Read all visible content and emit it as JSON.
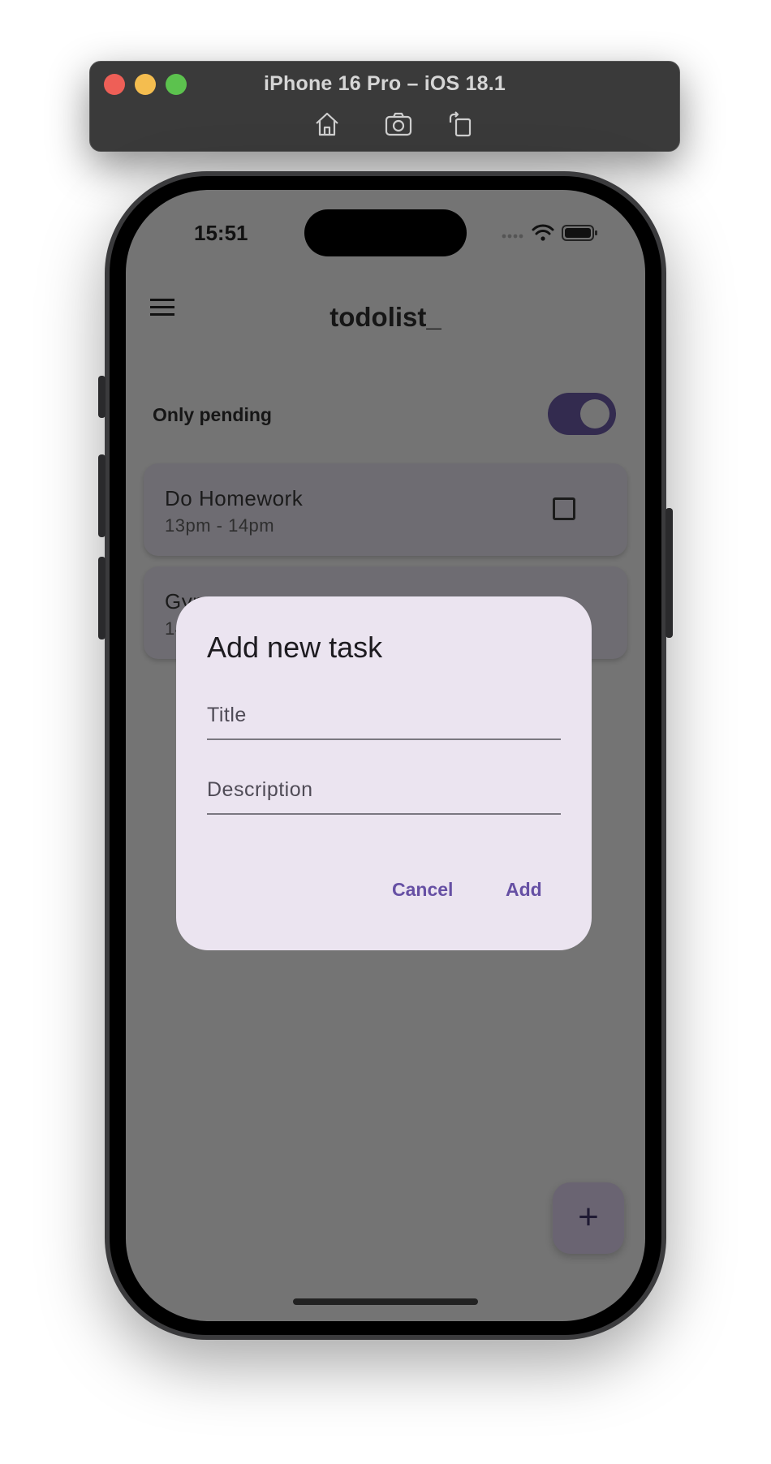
{
  "simulator": {
    "title": "iPhone 16 Pro – iOS 18.1",
    "toolbar_icons": [
      "home-icon",
      "screenshot-icon",
      "rotate-icon"
    ]
  },
  "status_bar": {
    "time": "15:51",
    "icons": [
      "cellular-icon",
      "wifi-icon",
      "battery-icon"
    ]
  },
  "app": {
    "title": "todolist_",
    "filter_label": "Only pending",
    "filter_enabled": true
  },
  "tasks": [
    {
      "title": "Do Homework",
      "time": "13pm - 14pm",
      "done": false
    },
    {
      "title": "Gym",
      "time": "14",
      "done": false
    }
  ],
  "dialog": {
    "title": "Add new task",
    "title_placeholder": "Title",
    "description_placeholder": "Description",
    "cancel_label": "Cancel",
    "add_label": "Add"
  },
  "fab": {
    "label": "+"
  },
  "colors": {
    "accent": "#6650a4",
    "toggle": "#332b4f",
    "dialog_bg": "#ebe4f0",
    "scrim": "#747474"
  }
}
